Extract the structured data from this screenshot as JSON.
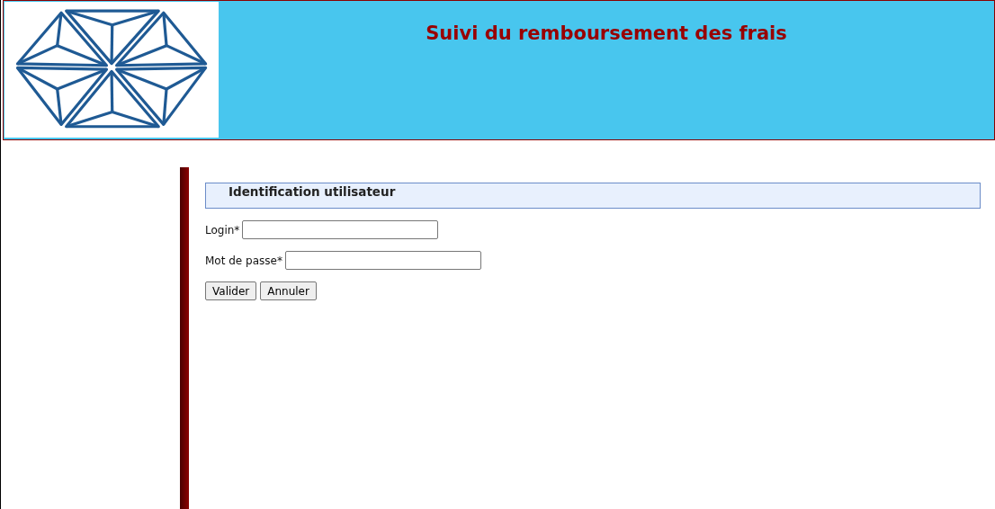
{
  "header": {
    "title": "Suivi du remboursement des frais"
  },
  "form": {
    "legend": "Identification utilisateur",
    "fields": [
      {
        "label": "Login*"
      },
      {
        "label": "Mot de passe*"
      }
    ],
    "buttons": [
      "Valider",
      "Annuler"
    ]
  }
}
